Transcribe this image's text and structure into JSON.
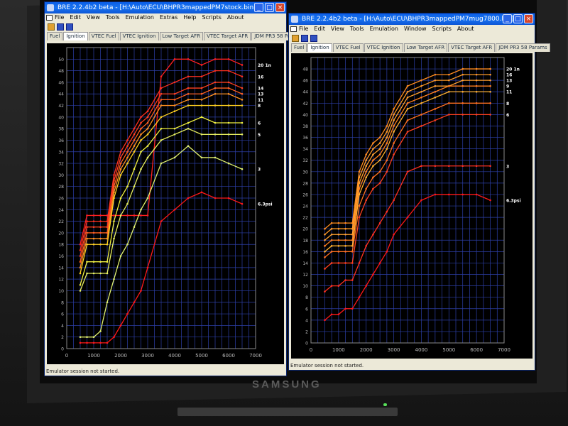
{
  "brand": "SAMSUNG",
  "colors": {
    "grid": "#2d3fa8",
    "axis": "#8a8a8a",
    "bg": "#000000"
  },
  "windows": [
    {
      "title": "BRE 2.2.4b2 beta - [H:\\Auto\\ECU\\BHPR3mappedPM7stock.bin]",
      "menu": [
        "File",
        "Edit",
        "View",
        "Tools",
        "Emulation",
        "Extras",
        "Help",
        "Scripts",
        "About"
      ],
      "tabs": [
        "Fuel",
        "Ignition",
        "VTEC Fuel",
        "VTEC Ignition",
        "Low Target AFR",
        "VTEC Target AFR",
        "JDM PR3 58 Params"
      ],
      "active_tab": "Ignition",
      "status": "Emulator session not started."
    },
    {
      "title": "BRE 2.2.4b2 beta - [H:\\Auto\\ECU\\BHPR3mappedPM7mug7800.bin]",
      "menu": [
        "File",
        "Edit",
        "View",
        "Tools",
        "Emulation",
        "Window",
        "Scripts",
        "About"
      ],
      "tabs": [
        "Fuel",
        "Ignition",
        "VTEC Fuel",
        "VTEC Ignition",
        "Low Target AFR",
        "VTEC Target AFR",
        "JDM PR3 58 Params"
      ],
      "active_tab": "Ignition",
      "status": "Emulator session not started."
    }
  ],
  "chart_data": [
    {
      "type": "line",
      "title": "",
      "xlabel": "",
      "ylabel": "",
      "xlim": [
        0,
        7000
      ],
      "ylim": [
        0,
        52
      ],
      "xticks": [
        0,
        1000,
        2000,
        3000,
        4000,
        5000,
        6000,
        7000
      ],
      "yticks": [
        0,
        2,
        4,
        6,
        8,
        10,
        12,
        14,
        16,
        18,
        20,
        22,
        24,
        26,
        28,
        30,
        32,
        34,
        36,
        38,
        40,
        42,
        44,
        46,
        48,
        50
      ],
      "x": [
        500,
        750,
        1000,
        1250,
        1500,
        1750,
        2000,
        2250,
        2500,
        2750,
        3000,
        3500,
        4000,
        4500,
        5000,
        5500,
        6000,
        6500
      ],
      "series": [
        {
          "name": "20 1n",
          "color": "#ff2020",
          "values": [
            18,
            23,
            23,
            23,
            23,
            23,
            23,
            23,
            23,
            23,
            23,
            47,
            50,
            50,
            49,
            50,
            50,
            49
          ]
        },
        {
          "name": "16",
          "color": "#ff3020",
          "values": [
            17,
            22,
            22,
            22,
            22,
            30,
            34,
            36,
            38,
            40,
            41,
            45,
            46,
            47,
            47,
            48,
            48,
            47
          ]
        },
        {
          "name": "14",
          "color": "#ff4020",
          "values": [
            16,
            21,
            21,
            21,
            21,
            29,
            33,
            35,
            37,
            39,
            40,
            44,
            44,
            45,
            45,
            46,
            46,
            45
          ]
        },
        {
          "name": "13",
          "color": "#ff6020",
          "values": [
            15,
            20,
            20,
            20,
            20,
            28,
            32,
            34,
            36,
            38,
            39,
            43,
            43,
            44,
            44,
            45,
            45,
            44
          ]
        },
        {
          "name": "11",
          "color": "#ff9020",
          "values": [
            14,
            19,
            19,
            19,
            19,
            27,
            31,
            33,
            35,
            37,
            38,
            42,
            42,
            43,
            43,
            44,
            44,
            43
          ]
        },
        {
          "name": "8",
          "color": "#ffd020",
          "values": [
            13,
            18,
            18,
            18,
            18,
            26,
            30,
            32,
            34,
            36,
            37,
            40,
            41,
            42,
            42,
            42,
            42,
            42
          ]
        },
        {
          "name": "6",
          "color": "#f0f040",
          "values": [
            11,
            15,
            15,
            15,
            15,
            22,
            26,
            28,
            31,
            34,
            35,
            38,
            38,
            39,
            40,
            39,
            39,
            39
          ]
        },
        {
          "name": "5",
          "color": "#e8f060",
          "values": [
            10,
            13,
            13,
            13,
            13,
            19,
            23,
            25,
            28,
            31,
            33,
            36,
            37,
            38,
            37,
            37,
            37,
            37
          ]
        },
        {
          "name": "3",
          "color": "#e0f070",
          "values": [
            2,
            2,
            2,
            3,
            8,
            12,
            16,
            18,
            21,
            24,
            26,
            32,
            33,
            35,
            33,
            33,
            32,
            31
          ]
        },
        {
          "name": "6.3psi",
          "color": "#ff1818",
          "values": [
            1,
            1,
            1,
            1,
            1,
            2,
            4,
            6,
            8,
            10,
            14,
            22,
            24,
            26,
            27,
            26,
            26,
            25
          ]
        }
      ]
    },
    {
      "type": "line",
      "title": "",
      "xlabel": "",
      "ylabel": "",
      "xlim": [
        0,
        7000
      ],
      "ylim": [
        0,
        50
      ],
      "xticks": [
        0,
        1000,
        2000,
        3000,
        4000,
        5000,
        6000,
        7000
      ],
      "yticks": [
        0,
        2,
        4,
        6,
        8,
        10,
        12,
        14,
        16,
        18,
        20,
        22,
        24,
        26,
        28,
        30,
        32,
        34,
        36,
        38,
        40,
        42,
        44,
        46,
        48
      ],
      "x": [
        500,
        750,
        1000,
        1250,
        1500,
        1750,
        2000,
        2250,
        2500,
        2750,
        3000,
        3500,
        4000,
        4500,
        5000,
        5500,
        6000,
        6500
      ],
      "series": [
        {
          "name": "20 1n",
          "color": "#ff8c20",
          "values": [
            20,
            21,
            21,
            21,
            21,
            30,
            33,
            35,
            36,
            38,
            41,
            45,
            46,
            47,
            47,
            48,
            48,
            48
          ]
        },
        {
          "name": "16",
          "color": "#ff9a28",
          "values": [
            19,
            20,
            20,
            20,
            20,
            29,
            32,
            34,
            35,
            37,
            40,
            44,
            45,
            46,
            46,
            47,
            47,
            47
          ]
        },
        {
          "name": "13",
          "color": "#ffa030",
          "values": [
            18,
            19,
            19,
            19,
            19,
            28,
            31,
            33,
            34,
            36,
            39,
            43,
            44,
            45,
            45,
            46,
            46,
            46
          ]
        },
        {
          "name": "9",
          "color": "#ff8020",
          "values": [
            17,
            18,
            18,
            18,
            18,
            27,
            30,
            32,
            33,
            35,
            38,
            42,
            43,
            44,
            45,
            45,
            45,
            45
          ]
        },
        {
          "name": "11",
          "color": "#ffb030",
          "values": [
            16,
            17,
            17,
            17,
            17,
            26,
            29,
            31,
            32,
            34,
            37,
            41,
            42,
            43,
            44,
            44,
            44,
            44
          ]
        },
        {
          "name": "8",
          "color": "#ff7020",
          "values": [
            15,
            16,
            16,
            16,
            16,
            24,
            27,
            29,
            30,
            32,
            35,
            39,
            40,
            41,
            42,
            42,
            42,
            42
          ]
        },
        {
          "name": "6",
          "color": "#ff4020",
          "values": [
            13,
            14,
            14,
            14,
            14,
            22,
            25,
            27,
            28,
            30,
            33,
            37,
            38,
            39,
            40,
            40,
            40,
            40
          ]
        },
        {
          "name": "3",
          "color": "#ff3020",
          "values": [
            9,
            10,
            10,
            11,
            11,
            14,
            17,
            19,
            21,
            23,
            25,
            30,
            31,
            31,
            31,
            31,
            31,
            31
          ]
        },
        {
          "name": "6.3psi",
          "color": "#ff1818",
          "values": [
            4,
            5,
            5,
            6,
            6,
            8,
            10,
            12,
            14,
            16,
            19,
            22,
            25,
            26,
            26,
            26,
            26,
            25
          ]
        }
      ]
    }
  ]
}
